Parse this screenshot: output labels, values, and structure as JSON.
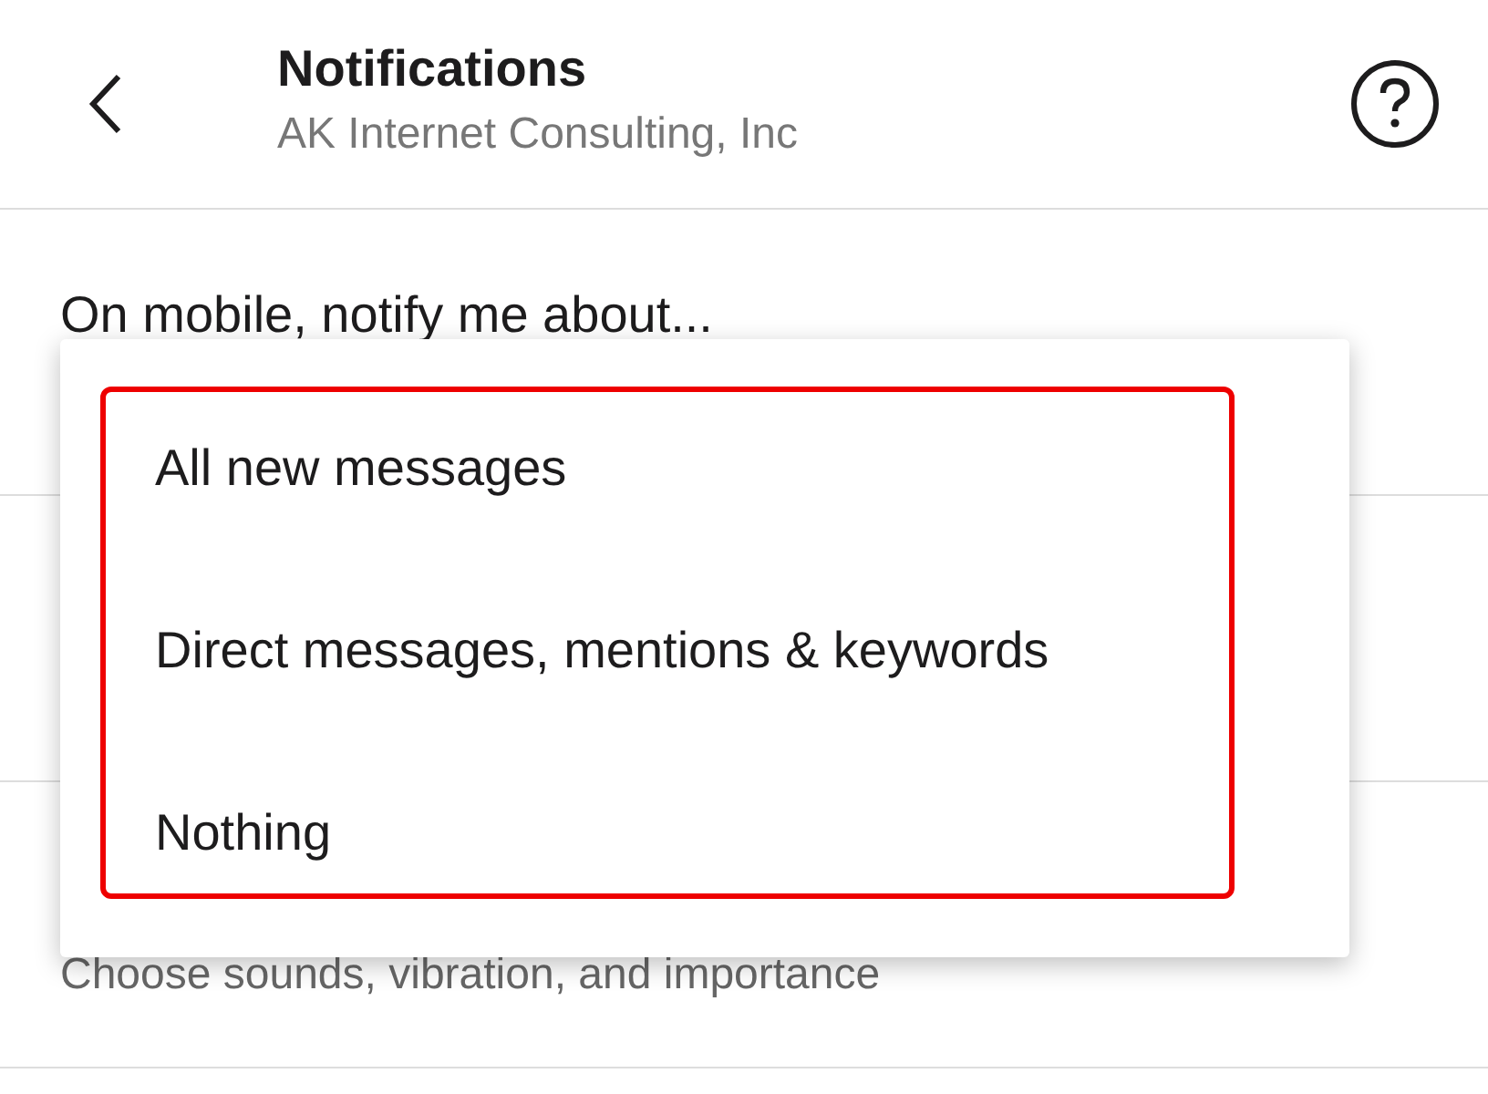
{
  "header": {
    "title": "Notifications",
    "subtitle": "AK Internet Consulting, Inc"
  },
  "settings": [
    {
      "title": "On mobile, notify me about..."
    },
    {
      "description": "Choose sounds, vibration, and importance"
    }
  ],
  "menu": {
    "highlighted": true,
    "items": [
      {
        "label": "All new messages"
      },
      {
        "label": "Direct messages, mentions & keywords"
      },
      {
        "label": "Nothing"
      }
    ]
  }
}
